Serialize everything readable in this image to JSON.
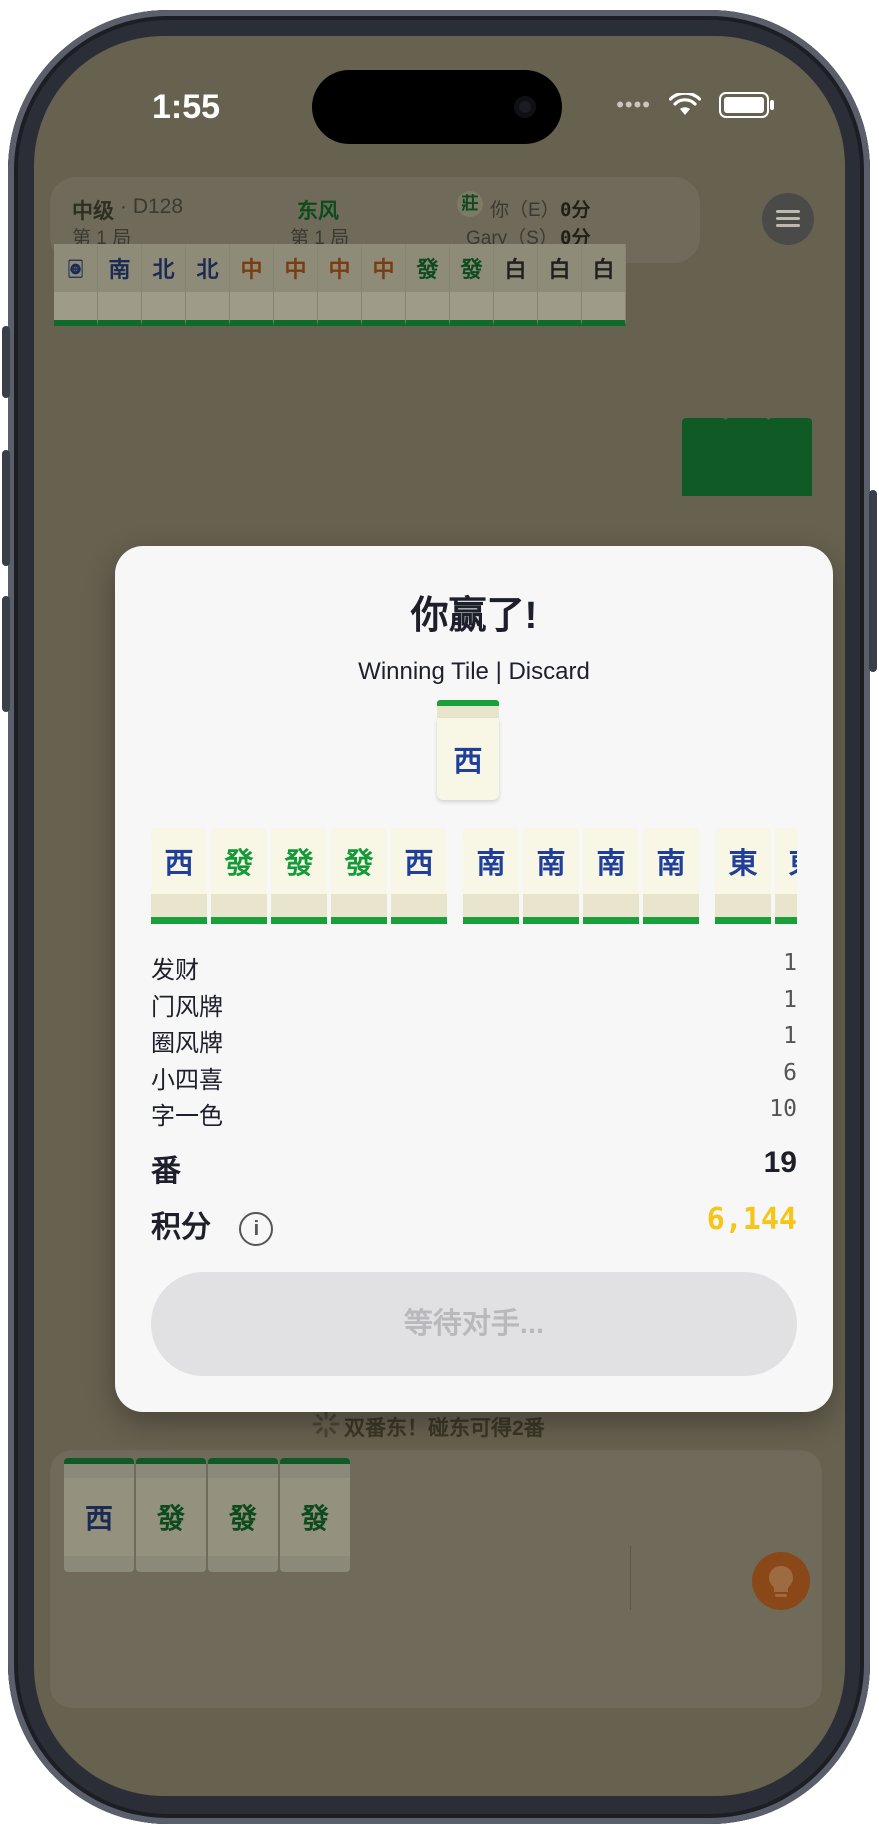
{
  "status_bar": {
    "time": "1:55",
    "signal": "••••"
  },
  "topbar": {
    "level": "中级",
    "game_id": "· D128",
    "round_left": "第 1 局",
    "wind": "东风",
    "round_center": "第 1 局",
    "dealer_badge": "莊",
    "player1": "你（E）",
    "player1_score": "0分",
    "player2": "Gary（S）",
    "player2_score": "0分"
  },
  "opponent_tiles": [
    "🀙",
    "南",
    "北",
    "北",
    "中",
    "中",
    "中",
    "中",
    "發",
    "發",
    "白",
    "白",
    "白"
  ],
  "modal": {
    "title": "你赢了!",
    "winning_label": "Winning Tile | Discard",
    "winning_tile": "西",
    "hand": [
      "西",
      "發",
      "發",
      "發",
      "西",
      "南",
      "南",
      "南",
      "南",
      "東",
      "東"
    ],
    "fans": [
      {
        "name": "发财",
        "value": "1"
      },
      {
        "name": "门风牌",
        "value": "1"
      },
      {
        "name": "圈风牌",
        "value": "1"
      },
      {
        "name": "小四喜",
        "value": "6"
      },
      {
        "name": "字一色",
        "value": "10"
      }
    ],
    "total_fan_label": "番",
    "total_fan_value": "19",
    "score_label": "积分",
    "score_value": "6,144",
    "info_symbol": "i",
    "wait_button": "等待对手..."
  },
  "hint_text": "双番东！碰东可得2番",
  "my_tiles": [
    "西",
    "發",
    "發",
    "發"
  ],
  "colors": {
    "accent_gold": "#f5c518",
    "tile_blue": "#1f3f9a",
    "tile_green": "#149a3a",
    "tile_red": "#c0392b",
    "tile_bar_green": "#19a03a"
  }
}
